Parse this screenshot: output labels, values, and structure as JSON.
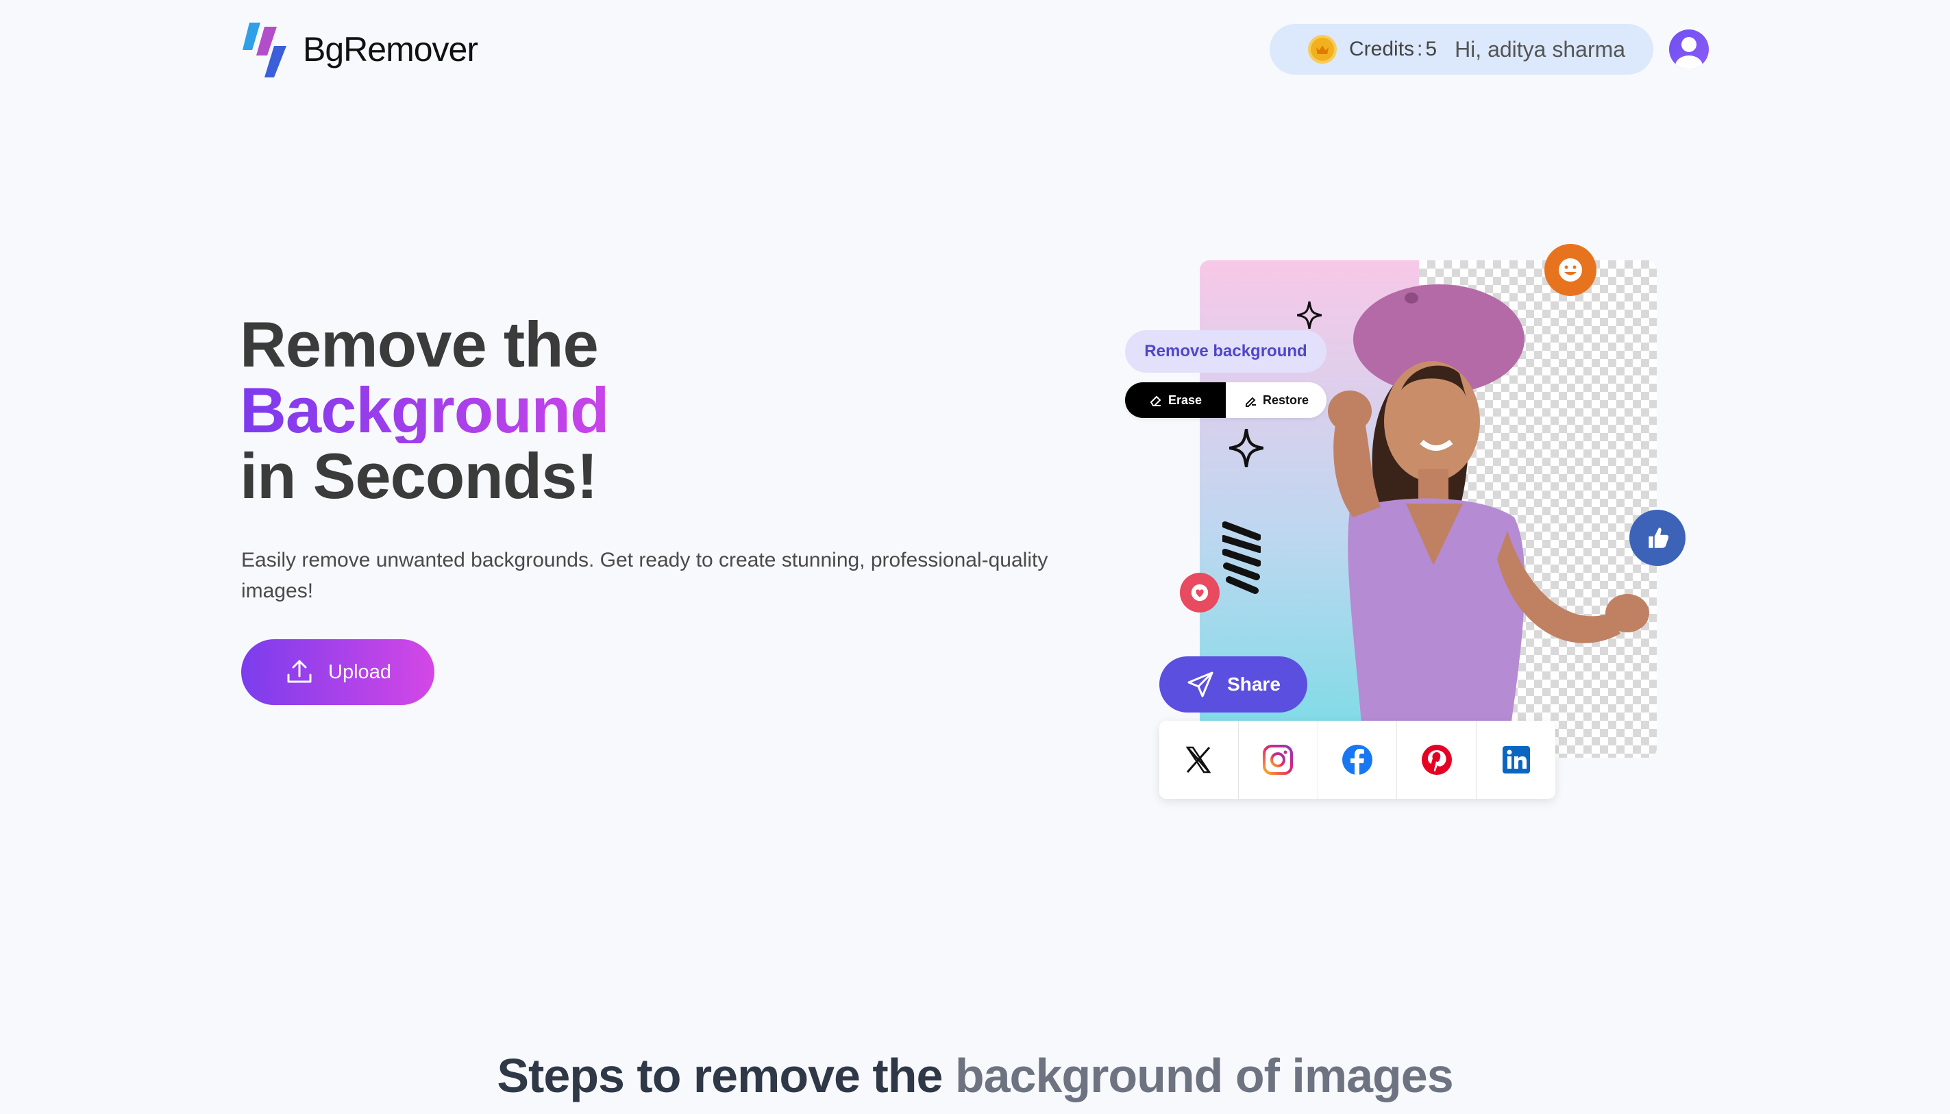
{
  "header": {
    "logo_text": "BgRemover",
    "credits_label": "Credits",
    "credits_sep": ":",
    "credits_value": "5",
    "greeting": "Hi, aditya sharma"
  },
  "hero": {
    "title_line1": "Remove the",
    "title_line2": "Background",
    "title_line3": "in Seconds!",
    "description": "Easily remove unwanted backgrounds. Get ready to create stunning, professional-quality images!",
    "upload_label": "Upload"
  },
  "illustration": {
    "remove_bg_label": "Remove background",
    "erase_label": "Erase",
    "restore_label": "Restore",
    "share_label": "Share",
    "socials": [
      "x-icon",
      "instagram-icon",
      "facebook-icon",
      "pinterest-icon",
      "linkedin-icon"
    ]
  },
  "steps": {
    "title_part1": "Steps to remove the",
    "title_part2": "background of images"
  },
  "colors": {
    "accent_start": "#7b3ded",
    "accent_end": "#d447e6",
    "credits_pill": "#dce8fb",
    "share": "#5b4fe0"
  }
}
